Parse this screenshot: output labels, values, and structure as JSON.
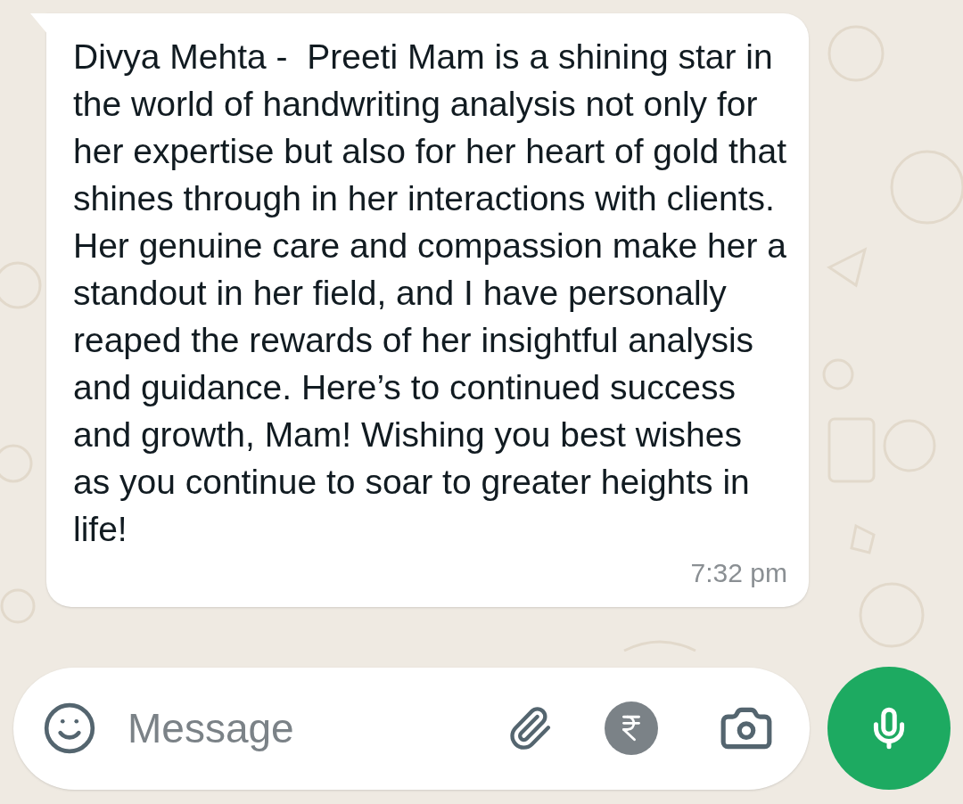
{
  "message": {
    "text": "Divya Mehta -  Preeti Mam is a shining star in the world of handwriting analysis not only for her expertise but also for her heart of gold that shines through in her interactions with clients. Her genuine care and compassion make her a standout in her field, and I have personally reaped the rewards of her insightful analysis and guidance. Here’s to continued success and growth, Mam! Wishing you best wishes as you continue to soar to greater heights in life!",
    "time": "7:32 pm"
  },
  "composer": {
    "placeholder": "Message"
  }
}
